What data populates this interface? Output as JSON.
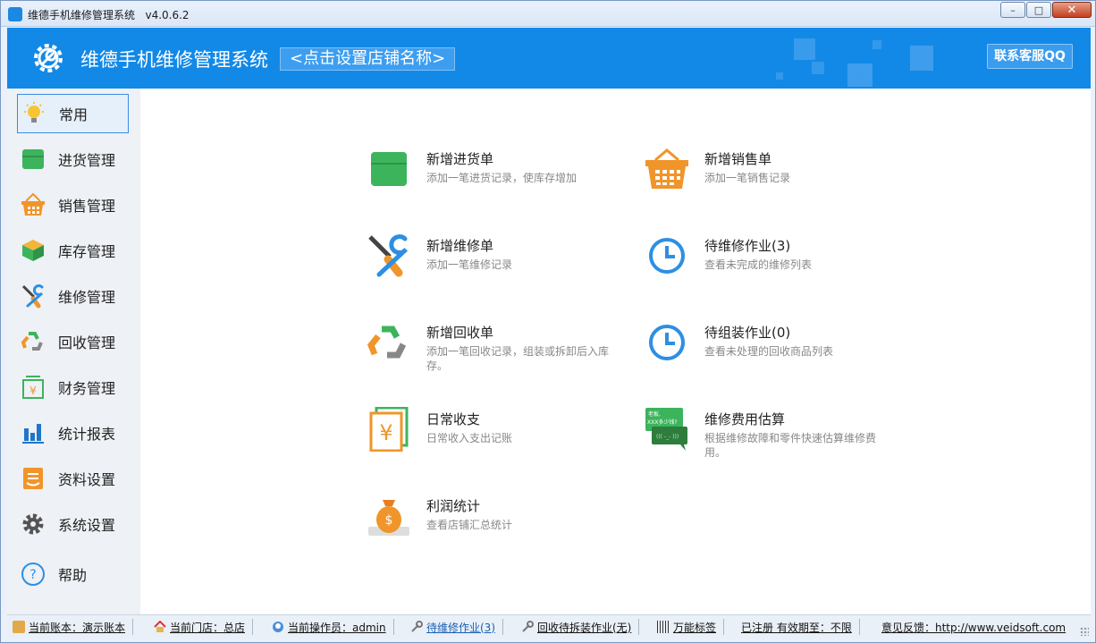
{
  "window": {
    "title": "维德手机维修管理系统",
    "version": "v4.0.6.2",
    "controls": {
      "minimize": "–",
      "maximize": "□",
      "close": "✕"
    }
  },
  "header": {
    "system_name": "维德手机维修管理系统",
    "shop_button": "<点击设置店铺名称>",
    "qq_button": "联系客服QQ"
  },
  "sidebar": {
    "items": [
      {
        "label": "常用",
        "icon": "lightbulb-icon",
        "active": true
      },
      {
        "label": "进货管理",
        "icon": "box-icon"
      },
      {
        "label": "销售管理",
        "icon": "basket-icon"
      },
      {
        "label": "库存管理",
        "icon": "inventory-icon"
      },
      {
        "label": "维修管理",
        "icon": "tools-icon"
      },
      {
        "label": "回收管理",
        "icon": "recycle-icon"
      },
      {
        "label": "财务管理",
        "icon": "finance-icon"
      },
      {
        "label": "统计报表",
        "icon": "bar-chart-icon"
      },
      {
        "label": "资料设置",
        "icon": "document-icon"
      },
      {
        "label": "系统设置",
        "icon": "gear-icon"
      },
      {
        "label": "帮助",
        "icon": "help-icon"
      }
    ]
  },
  "tiles": [
    {
      "title": "新增进货单",
      "desc": "添加一笔进货记录，使库存增加",
      "icon": "box-icon"
    },
    {
      "title": "新增销售单",
      "desc": "添加一笔销售记录",
      "icon": "basket-icon"
    },
    {
      "title": "新增维修单",
      "desc": "添加一笔维修记录",
      "icon": "tools-icon"
    },
    {
      "title": "待维修作业(3)",
      "desc": "查看未完成的维修列表",
      "icon": "clock-icon"
    },
    {
      "title": "新增回收单",
      "desc": "添加一笔回收记录，组装或拆卸后入库存。",
      "icon": "recycle-icon"
    },
    {
      "title": "待组装作业(0)",
      "desc": "查看未处理的回收商品列表",
      "icon": "clock-icon"
    },
    {
      "title": "日常收支",
      "desc": "日常收入支出记账",
      "icon": "yuan-icon"
    },
    {
      "title": "维修费用估算",
      "desc": "根据维修故障和零件快速估算维修费用。",
      "icon": "chat-bubbles-icon",
      "bubble_text_1": "老板,",
      "bubble_text_2": "XXX多少钱?",
      "bubble_text_3": "((( -_- )))"
    },
    {
      "title": "利润统计",
      "desc": "查看店铺汇总统计",
      "icon": "money-bag-icon"
    }
  ],
  "statusbar": {
    "items": [
      {
        "text": "当前账本：演示账本",
        "icon": "book-icon"
      },
      {
        "text": "当前门店：总店",
        "icon": "house-icon"
      },
      {
        "text": "当前操作员：admin",
        "icon": "user-icon"
      },
      {
        "text": "待维修作业(3)",
        "icon": "wrench-icon",
        "link": true
      },
      {
        "text": "回收待拆装作业(无)",
        "icon": "wrench-icon"
      },
      {
        "text": "万能标签",
        "icon": "barcode-icon"
      },
      {
        "text": "已注册 有效期至：不限",
        "icon": ""
      },
      {
        "text": "意见反馈：http://www.veidsoft.com",
        "icon": ""
      }
    ]
  },
  "colors": {
    "accent": "#1389e7",
    "green": "#3cb45c",
    "orange": "#f0952a",
    "blue": "#2d8fe3"
  }
}
